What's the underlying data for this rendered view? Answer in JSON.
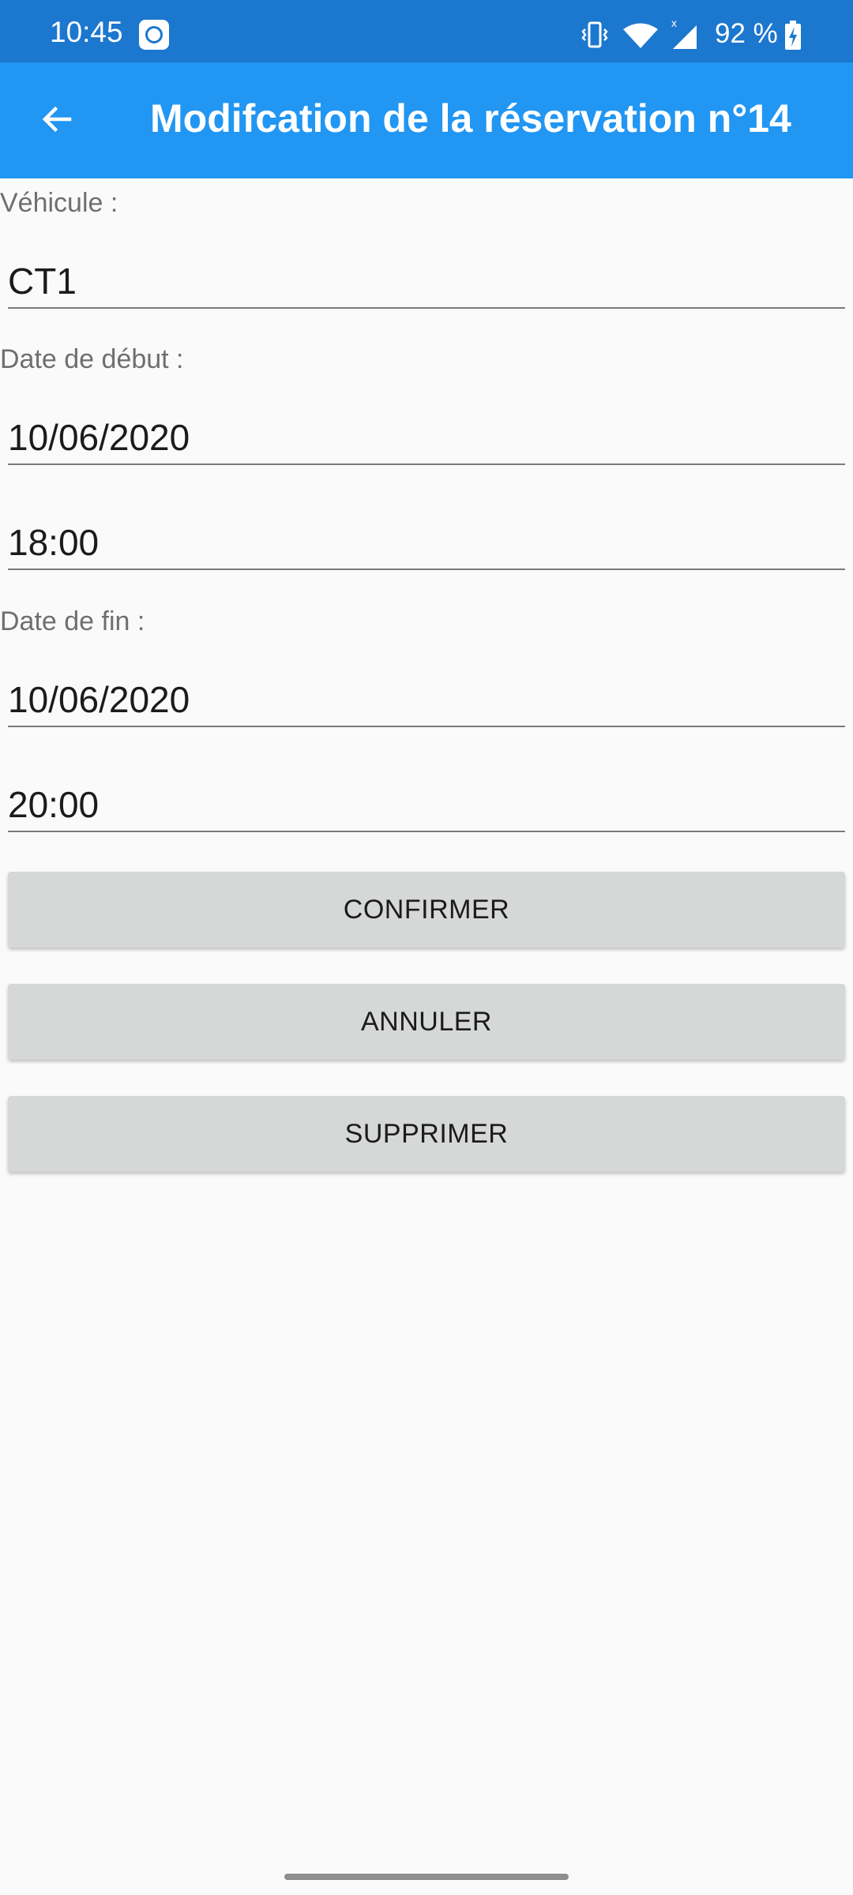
{
  "status_bar": {
    "time": "10:45",
    "battery": "92 %",
    "icons": [
      "app-notification-icon",
      "vibrate-icon",
      "wifi-icon",
      "signal-icon",
      "battery-charging-icon"
    ]
  },
  "app_bar": {
    "title": "Modifcation de la réservation n°14",
    "back_icon": "arrow-left-icon",
    "color": "#2196f3",
    "status_color": "#1c77cf"
  },
  "form": {
    "vehicle_label": "Véhicule :",
    "vehicle_value": "CT1",
    "start_label": "Date de début :",
    "start_date": "10/06/2020",
    "start_time": "18:00",
    "end_label": "Date de fin :",
    "end_date": "10/06/2020",
    "end_time": "20:00"
  },
  "buttons": {
    "confirm": "CONFIRMER",
    "cancel": "ANNULER",
    "delete": "SUPPRIMER"
  }
}
